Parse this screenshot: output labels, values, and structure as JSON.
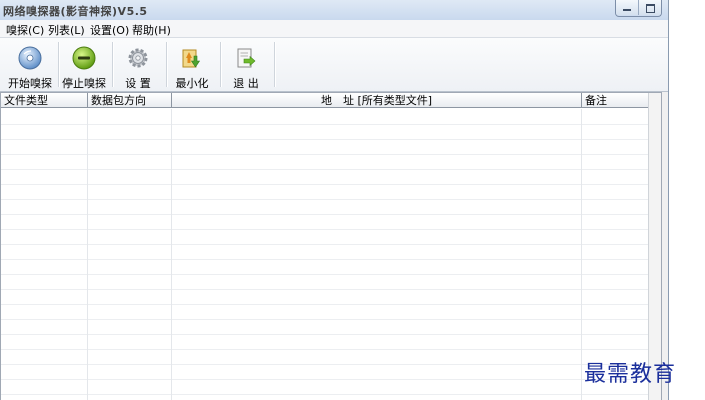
{
  "window": {
    "title": "网络嗅探器(影音神探)V5.5"
  },
  "menu": [
    "嗅探(C)",
    "列表(L)",
    "设置(O)",
    "帮助(H)"
  ],
  "toolbar": {
    "start": "开始嗅探",
    "stop": "停止嗅探",
    "settings": "设 置",
    "minimize": "最小化",
    "exit": "退 出"
  },
  "table": {
    "columns": [
      "文件类型",
      "数据包方向",
      "地　址 [所有类型文件]",
      "备注"
    ]
  },
  "watermark": "最需教育"
}
